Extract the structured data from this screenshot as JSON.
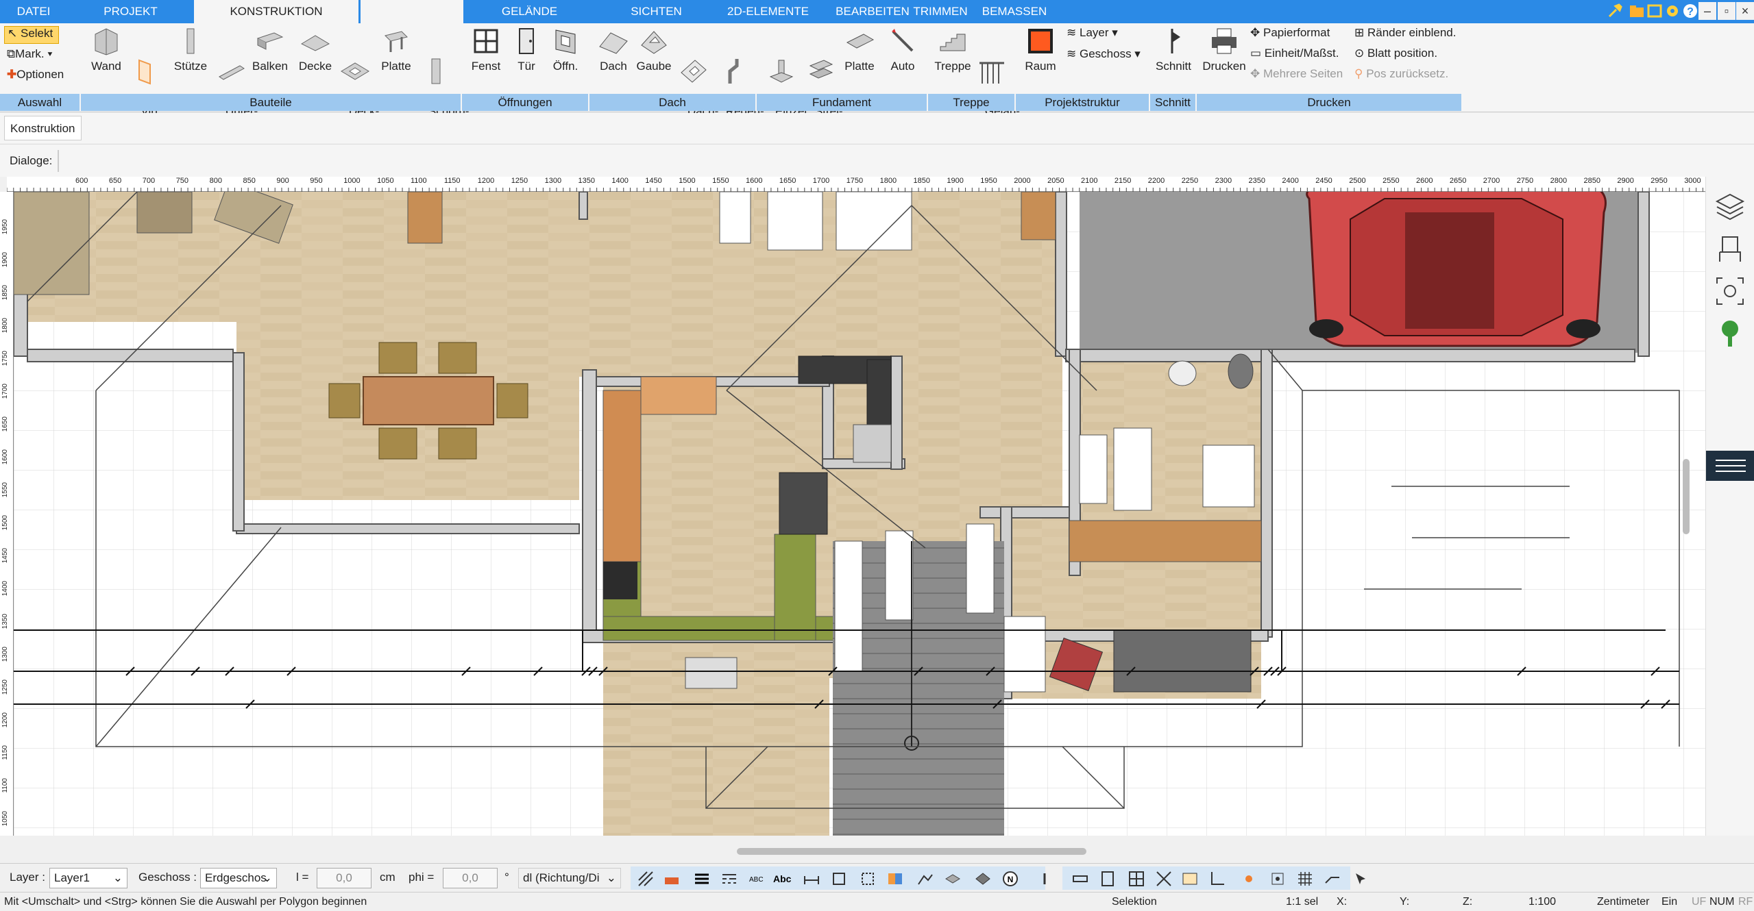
{
  "tabs": [
    {
      "label": "DATEI"
    },
    {
      "label": "PROJEKT"
    },
    {
      "label": "KONSTRUKTION"
    },
    {
      "label": ""
    },
    {
      "label": "GELÄNDE"
    },
    {
      "label": "SICHTEN"
    },
    {
      "label": "2D-ELEMENTE"
    },
    {
      "label": "BEARBEITEN"
    },
    {
      "label": "TRIMMEN"
    },
    {
      "label": "BEMASSEN"
    }
  ],
  "selection_group": {
    "selekt": "Selekt",
    "mark": "Mark.",
    "optionen": "Optionen"
  },
  "ribbon_buttons": {
    "wand": "Wand",
    "virt_wand": "Virt.\nWand",
    "stuetze": "Stütze",
    "unterzug": "Unter-\nzug",
    "balken": "Balken",
    "decke": "Decke",
    "deckoeffn": "Deck-\nöffn.",
    "platte": "Platte",
    "schornstein": "Schorn-\nstein",
    "fenst": "Fenst",
    "tuer": "Tür",
    "oeffn": "Öffn.",
    "dach": "Dach",
    "gaube": "Gaube",
    "dachfenster": "Dach-\nfenster",
    "regenfallrohr": "Regen-\nfallrohr",
    "einzelfund": "Einzel\nFund.",
    "streifen": "Strei-\nfen",
    "fund_platte": "Platte",
    "auto": "Auto",
    "treppe": "Treppe",
    "gelaender": "Gelän-\nder",
    "raum": "Raum",
    "schnitt": "Schnitt",
    "drucken": "Drucken"
  },
  "projektstruktur": {
    "layer": "Layer",
    "geschoss": "Geschoss"
  },
  "print_options": {
    "papierformat": "Papierformat",
    "einheit": "Einheit/Maßst.",
    "mehrere_seiten": "Mehrere Seiten",
    "raender": "Ränder einblend.",
    "blatt": "Blatt position.",
    "pos": "Pos zurücksetz."
  },
  "groups": [
    "Auswahl",
    "Bauteile",
    "Öffnungen",
    "Dach",
    "Fundament",
    "Treppe",
    "Projektstruktur",
    "Schnitt",
    "Drucken"
  ],
  "sub_tab": "Konstruktion",
  "dialoge_label": "Dialoge:",
  "ruler_top": [
    "600",
    "650",
    "700",
    "750",
    "800",
    "850",
    "900",
    "950",
    "1000",
    "1050",
    "1100",
    "1150",
    "1200",
    "1250",
    "1300",
    "1350",
    "1400",
    "1450",
    "1500",
    "1550",
    "1600",
    "1650",
    "1700",
    "1750",
    "1800",
    "1850",
    "1900",
    "1950",
    "2000",
    "2050",
    "2100",
    "2150",
    "2200",
    "2250",
    "2300",
    "2350",
    "2400",
    "2450",
    "2500",
    "2550",
    "2600",
    "2650",
    "2700",
    "2750",
    "2800",
    "2850",
    "2900",
    "2950",
    "3000"
  ],
  "ruler_left": [
    "1950",
    "1900",
    "1850",
    "1800",
    "1750",
    "1700",
    "1650",
    "1600",
    "1550",
    "1500",
    "1450",
    "1400",
    "1350",
    "1300",
    "1250",
    "1200",
    "1150",
    "1100",
    "1050"
  ],
  "toolbar": {
    "layer_label": "Layer :",
    "layer_value": "Layer1",
    "geschoss_label": "Geschoss :",
    "geschoss_value": "Erdgeschos",
    "l_label": "l =",
    "l_value": "0,0",
    "unit": "cm",
    "phi_label": "phi =",
    "phi_value": "0,0",
    "deg": "°",
    "mode_value": "dl (Richtung/Di"
  },
  "status": {
    "hint": "Mit <Umschalt> und <Strg> können Sie die Auswahl per Polygon beginnen",
    "mode": "Selektion",
    "sel": "1:1 sel",
    "x": "X:",
    "y": "Y:",
    "z": "Z:",
    "scale": "1:100",
    "unit": "Zentimeter",
    "ein": "Ein",
    "uf": "UF",
    "num": "NUM",
    "rf": "RF"
  },
  "colors": {
    "tab_blue": "#2b8ae6",
    "group_blue": "#9dc8ef",
    "floor": "#d9c8a8",
    "car": "#d24b4b"
  }
}
